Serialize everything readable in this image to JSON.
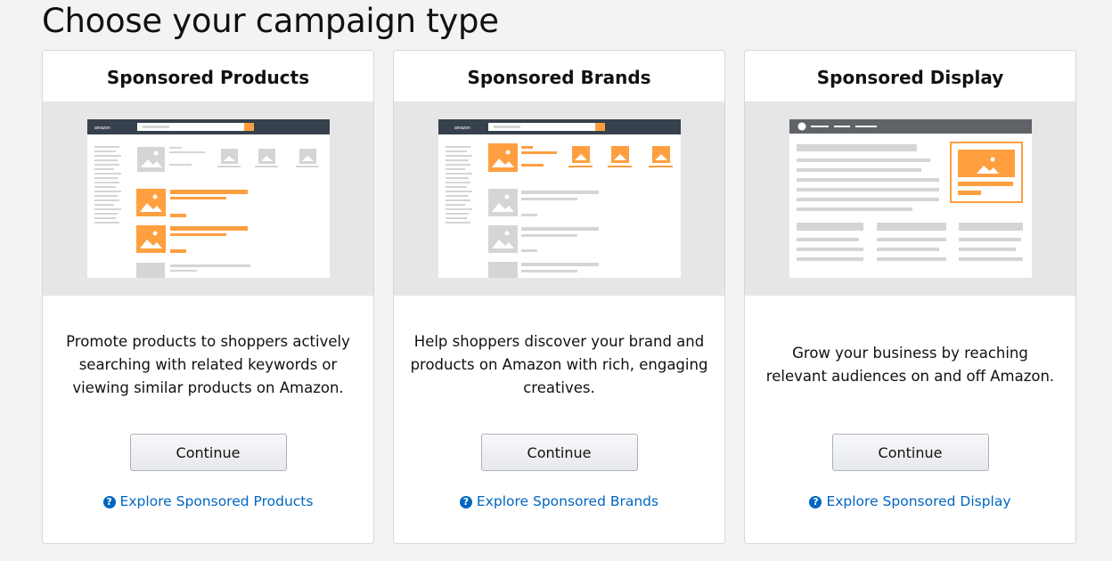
{
  "page": {
    "title": "Choose your campaign type"
  },
  "cards": [
    {
      "title": "Sponsored Products",
      "description": "Promote products to shoppers actively searching with related keywords or viewing similar products on Amazon.",
      "button_label": "Continue",
      "link_label": "Explore Sponsored Products",
      "mock_logo": "amazon"
    },
    {
      "title": "Sponsored Brands",
      "description": "Help shoppers discover your brand and products on Amazon with rich, engaging creatives.",
      "button_label": "Continue",
      "link_label": "Explore Sponsored Brands",
      "mock_logo": "amazon"
    },
    {
      "title": "Sponsored Display",
      "description": "Grow your business by reaching relevant audiences on and off Amazon.",
      "button_label": "Continue",
      "link_label": "Explore Sponsored Display"
    }
  ],
  "colors": {
    "accent": "#ff9f40",
    "link": "#0066c0",
    "header_bar": "#37414d"
  },
  "icons": {
    "help": "question-circle-icon",
    "image_placeholder": "image-icon"
  }
}
